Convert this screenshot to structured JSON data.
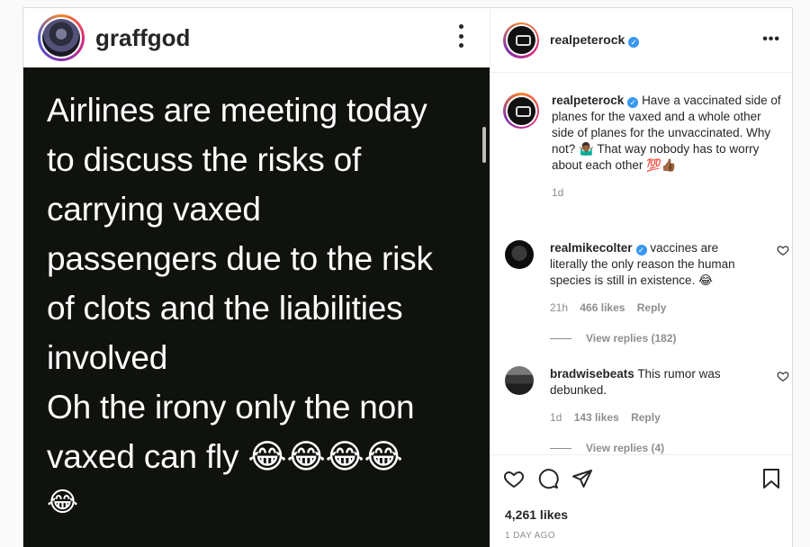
{
  "post": {
    "username": "graffgod",
    "text": "Airlines are meeting today\nto discuss the risks of\ncarrying vaxed\npassengers due to the risk\nof clots and the liabilities\ninvolved\nOh the irony only the non\nvaxed can fly 😂😂😂😂",
    "trailing_emoji": "😂"
  },
  "panel": {
    "username": "realpeterock",
    "verified_icon": "verified-badge-icon",
    "more_icon": "more-horizontal-icon",
    "caption": {
      "username": "realpeterock",
      "text": "Have a vaccinated side of planes for the vaxed and a whole other side of planes for the unvaccinated. Why not? 🤷🏾‍♂️ That way nobody has to worry about each other 💯👍🏾",
      "age": "1d"
    },
    "comments": [
      {
        "username": "realmikecolter",
        "verified": true,
        "text": "vaccines are literally the only reason the human species is still in existence. 😂",
        "age": "21h",
        "likes": "466 likes",
        "reply": "Reply",
        "view_replies": "View replies (182)"
      },
      {
        "username": "bradwisebeats",
        "verified": false,
        "text": "This rumor was debunked.",
        "age": "1d",
        "likes": "143 likes",
        "reply": "Reply",
        "view_replies": "View replies (4)"
      }
    ],
    "likes": "4,261 likes",
    "time_ago": "1 DAY AGO"
  },
  "colors": {
    "verified": "#3897f0",
    "post_bg": "#0f120d",
    "muted": "#8e8e8e"
  }
}
